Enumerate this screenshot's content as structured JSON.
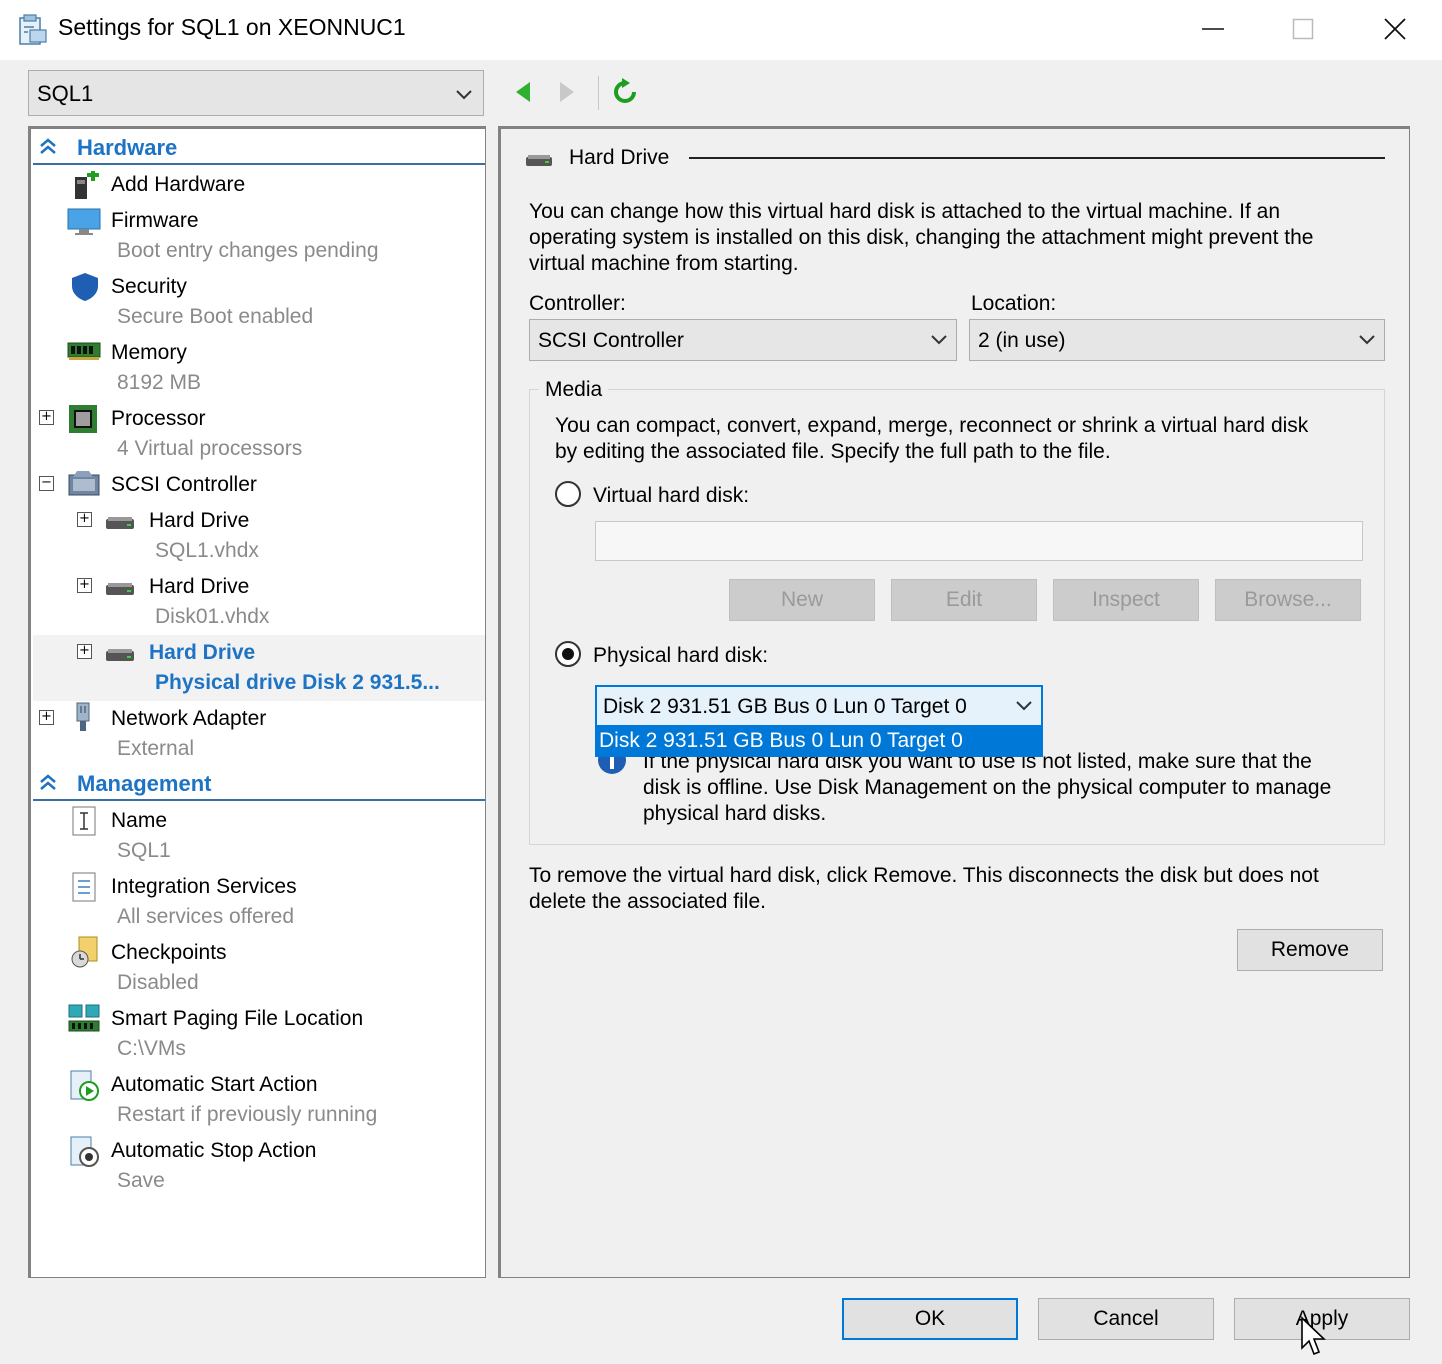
{
  "window": {
    "title": "Settings for SQL1 on XEONNUC1"
  },
  "vm_selector": {
    "value": "SQL1"
  },
  "tree": {
    "hardware_header": "Hardware",
    "management_header": "Management",
    "hardware_items": [
      {
        "label": "Add Hardware",
        "sub": "",
        "icon": "add-hardware-icon"
      },
      {
        "label": "Firmware",
        "sub": "Boot entry changes pending",
        "icon": "monitor-icon"
      },
      {
        "label": "Security",
        "sub": "Secure Boot enabled",
        "icon": "shield-icon"
      },
      {
        "label": "Memory",
        "sub": "8192 MB",
        "icon": "memory-icon"
      },
      {
        "label": "Processor",
        "sub": "4 Virtual processors",
        "icon": "processor-icon"
      },
      {
        "label": "SCSI Controller",
        "sub": "",
        "icon": "scsi-icon"
      },
      {
        "label": "Hard Drive",
        "sub": "SQL1.vhdx",
        "icon": "disk-icon"
      },
      {
        "label": "Hard Drive",
        "sub": "Disk01.vhdx",
        "icon": "disk-icon"
      },
      {
        "label": "Hard Drive",
        "sub": "Physical drive Disk 2 931.5...",
        "icon": "disk-icon"
      },
      {
        "label": "Network Adapter",
        "sub": "External",
        "icon": "network-adapter-icon"
      }
    ],
    "management_items": [
      {
        "label": "Name",
        "sub": "SQL1",
        "icon": "name-icon"
      },
      {
        "label": "Integration Services",
        "sub": "All services offered",
        "icon": "integration-icon"
      },
      {
        "label": "Checkpoints",
        "sub": "Disabled",
        "icon": "checkpoint-icon"
      },
      {
        "label": "Smart Paging File Location",
        "sub": "C:\\VMs",
        "icon": "paging-icon"
      },
      {
        "label": "Automatic Start Action",
        "sub": "Restart if previously running",
        "icon": "start-action-icon"
      },
      {
        "label": "Automatic Stop Action",
        "sub": "Save",
        "icon": "stop-action-icon"
      }
    ]
  },
  "detail": {
    "section_title": "Hard Drive",
    "intro_lines": [
      "You can change how this virtual hard disk is attached to the virtual machine. If an",
      "operating system is installed on this disk, changing the attachment might prevent the",
      "virtual machine from starting."
    ],
    "controller_label": "Controller:",
    "controller_value": "SCSI Controller",
    "location_label": "Location:",
    "location_value": "2 (in use)",
    "media_label": "Media",
    "media_lines": [
      "You can compact, convert, expand, merge, reconnect or shrink a virtual hard disk",
      "by editing the associated file. Specify the full path to the file."
    ],
    "vhd_radio_label": "Virtual hard disk:",
    "vhd_path_value": "",
    "buttons": {
      "new": "New",
      "edit": "Edit",
      "inspect": "Inspect",
      "browse": "Browse..."
    },
    "phys_radio_label": "Physical hard disk:",
    "phys_disk_value": "Disk 2 931.51 GB Bus 0 Lun 0 Target 0",
    "phys_dropdown_option": "Disk 2 931.51 GB Bus 0 Lun 0 Target 0",
    "info_lines": [
      "If the physical hard disk you want to use is not listed, make sure that the",
      "disk is offline. Use Disk Management on the physical computer to manage",
      "physical hard disks."
    ],
    "remove_lines": [
      "To remove the virtual hard disk, click Remove. This disconnects the disk but does not",
      "delete the associated file."
    ],
    "remove_button": "Remove"
  },
  "footer": {
    "ok": "OK",
    "cancel": "Cancel",
    "apply": "Apply"
  },
  "colors": {
    "accent": "#1d73c4",
    "selection": "#0078d7",
    "ok_border": "#0078d7",
    "disabled_bg": "#cccccc"
  }
}
